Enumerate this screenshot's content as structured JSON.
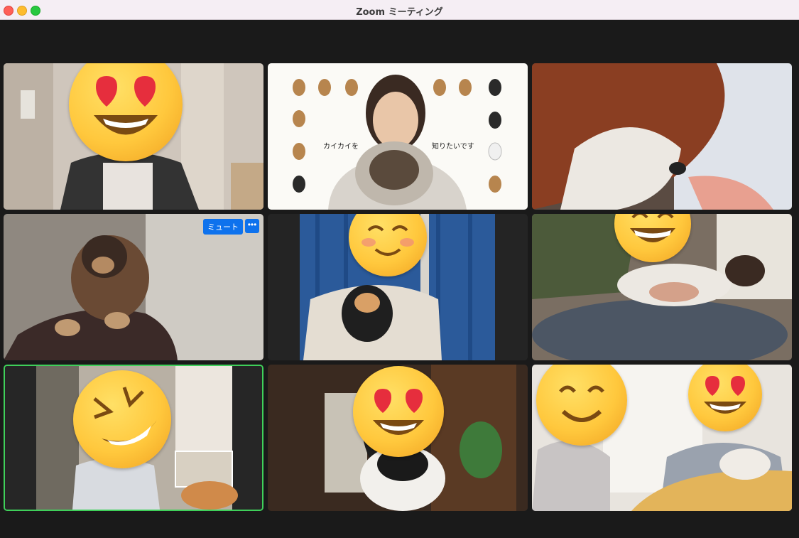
{
  "window": {
    "title": "Zoom ミーティング"
  },
  "slide": {
    "text_left": "カイカイを",
    "text_right": "知りたいです"
  },
  "participant_controls": {
    "mute_label": "ミュート",
    "more_label": "•••"
  },
  "tiles": [
    {
      "id": 1,
      "emoji": "heart-eyes-emoji",
      "active_speaker": false
    },
    {
      "id": 2,
      "emoji": "",
      "active_speaker": false
    },
    {
      "id": 3,
      "emoji": "",
      "active_speaker": false
    },
    {
      "id": 4,
      "emoji": "",
      "active_speaker": false
    },
    {
      "id": 5,
      "emoji": "smiling-blush-emoji",
      "active_speaker": false
    },
    {
      "id": 6,
      "emoji": "grinning-emoji",
      "active_speaker": false
    },
    {
      "id": 7,
      "emoji": "rolling-laughing-emoji",
      "active_speaker": true
    },
    {
      "id": 8,
      "emoji": "heart-eyes-emoji",
      "active_speaker": false
    },
    {
      "id": 9,
      "emoji": "smiling-eyes-emoji, heart-eyes-emoji",
      "active_speaker": false
    }
  ],
  "colors": {
    "active_speaker_border": "#3fd05a",
    "button_blue": "#0e72ed",
    "background": "#1a1a1a"
  }
}
